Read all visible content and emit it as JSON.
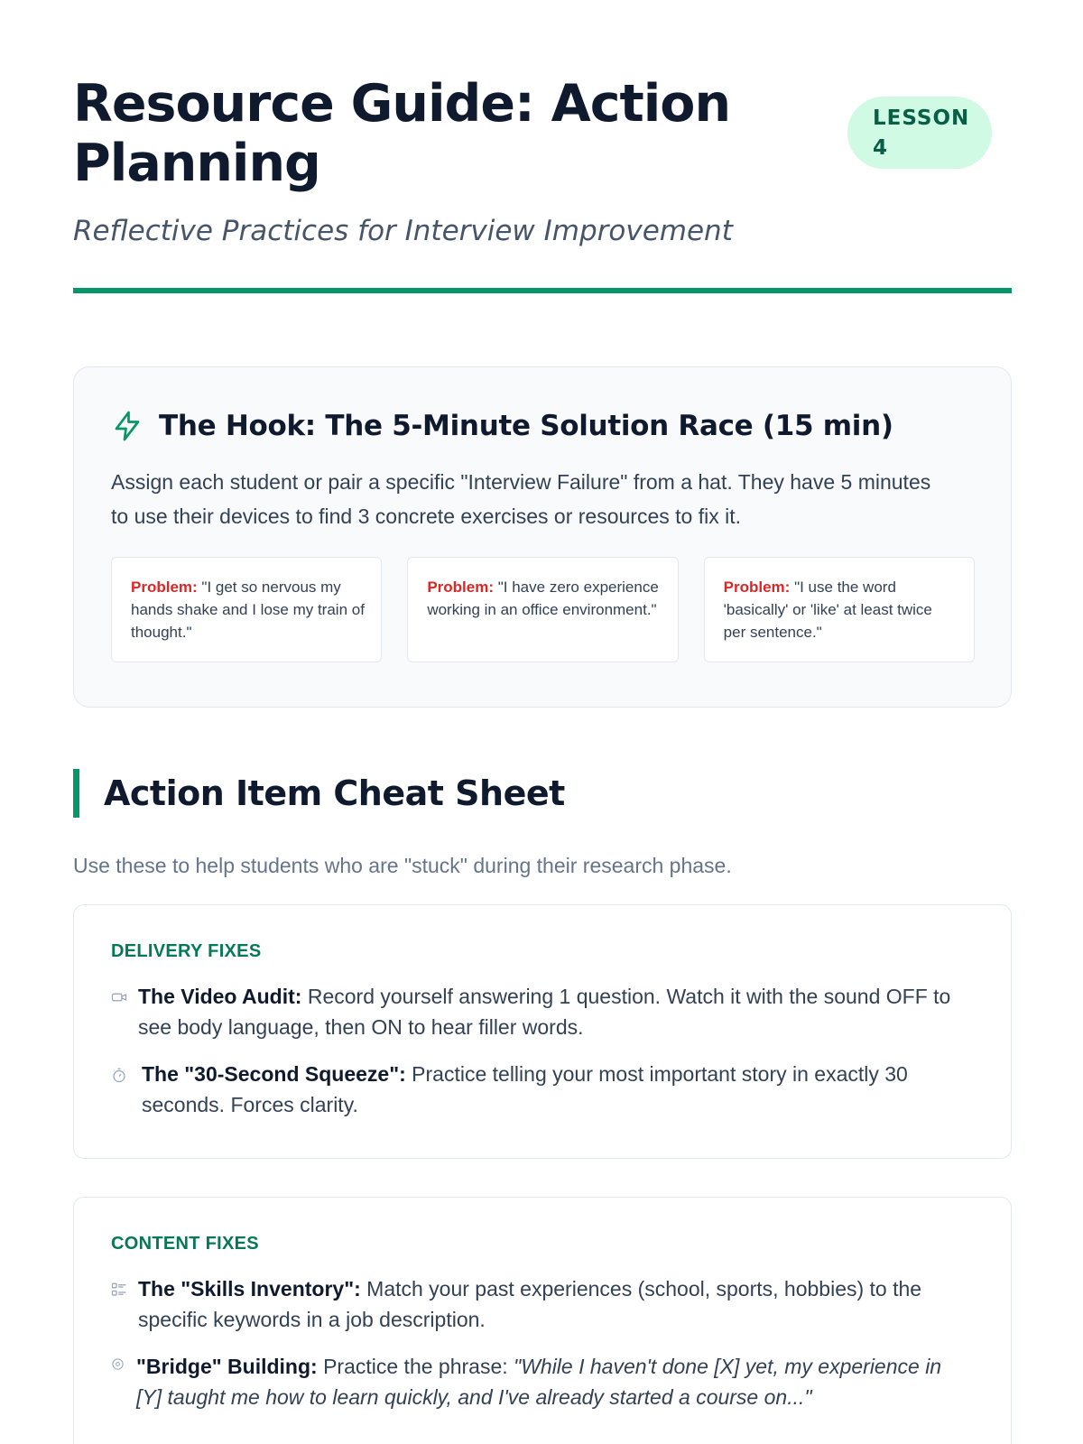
{
  "header": {
    "title": "Resource Guide: Action Planning",
    "subtitle": "Reflective Practices for Interview Improvement",
    "badge": "LESSON 4"
  },
  "hook": {
    "icon": "lightning-bolt-icon",
    "title": "The Hook: The 5-Minute Solution Race (15 min)",
    "description": "Assign each student or pair a specific \"Interview Failure\" from a hat. They have 5 minutes to use their devices to find 3 concrete exercises or resources to fix it.",
    "problem_label": "Problem:",
    "problems": [
      "\"I get so nervous my hands shake and I lose my train of thought.\"",
      "\"I have zero experience working in an office environment.\"",
      "\"I use the word 'basically' or 'like' at least twice per sentence.\""
    ]
  },
  "cheat_sheet": {
    "title": "Action Item Cheat Sheet",
    "intro": "Use these to help students who are \"stuck\" during their research phase.",
    "delivery": {
      "label": "DELIVERY FIXES",
      "items": [
        {
          "icon": "video-camera-icon",
          "name": "The Video Audit:",
          "text": " Record yourself answering 1 question. Watch it with the sound OFF to see body language, then ON to hear filler words."
        },
        {
          "icon": "stopwatch-icon",
          "name": "The \"30-Second Squeeze\":",
          "text": " Practice telling your most important story in exactly 30 seconds. Forces clarity."
        }
      ]
    },
    "content": {
      "label": "CONTENT FIXES",
      "items": [
        {
          "icon": "checklist-icon",
          "name": "The \"Skills Inventory\":",
          "text": " Match your past experiences (school, sports, hobbies) to the specific keywords in a job description."
        },
        {
          "icon": "target-icon",
          "name": "\"Bridge\" Building:",
          "text": " Practice the phrase: ",
          "quote": "\"While I haven't done [X] yet, my experience in [Y] taught me how to learn quickly, and I've already started a course on...\""
        }
      ]
    }
  },
  "colors": {
    "accent": "#059669",
    "badge_bg": "#d1fae5",
    "problem_label": "#dc2626"
  }
}
